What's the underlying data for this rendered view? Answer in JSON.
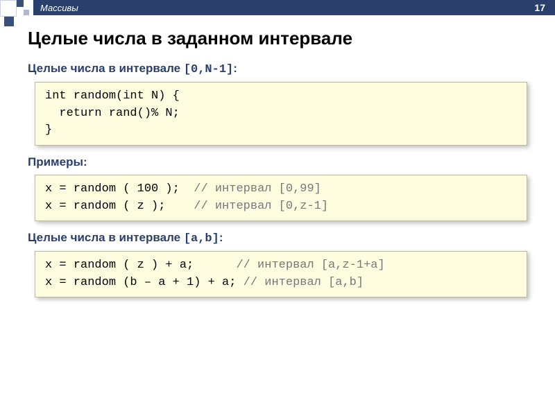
{
  "header": {
    "section_label": "Массивы",
    "page_number": "17"
  },
  "title": "Целые числа в заданном интервале",
  "subhead1_prefix": "Целые числа в интервале ",
  "subhead1_range": "[0,N-1]",
  "subhead1_colon": ":",
  "code1": {
    "l1a": "int random(int N) {",
    "l2a": "  return rand()% N;",
    "l3a": "}"
  },
  "subhead2": "Примеры:",
  "code2": {
    "l1a": "x = random ( 100 );  ",
    "l1c": "// интервал [0,99]",
    "l2a": "x = random ( z );    ",
    "l2c": "// интервал [0,z-1]"
  },
  "subhead3_prefix": "Целые числа в интервале ",
  "subhead3_range": "[a,b]",
  "subhead3_colon": ":",
  "code3": {
    "l1a": "x = random ( z ) + a;      ",
    "l1c": "// интервал [a,z-1+a]",
    "l2a": "x = random (b – a + 1) + a; ",
    "l2c": "// интервал [a,b]"
  }
}
